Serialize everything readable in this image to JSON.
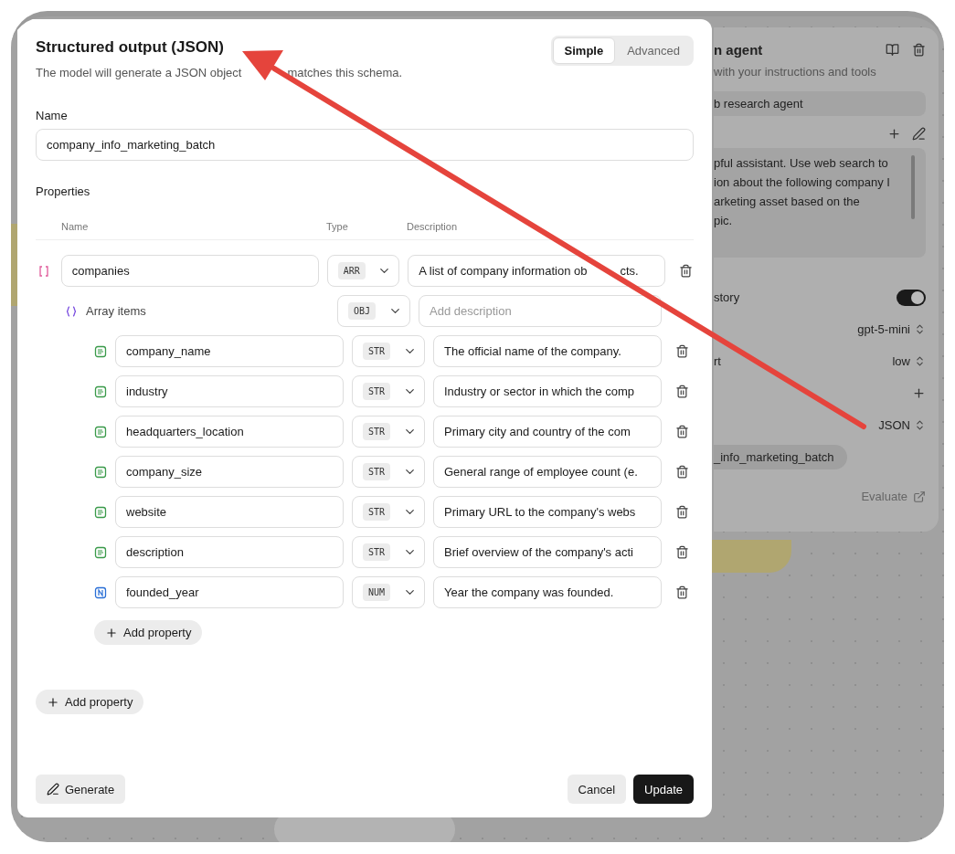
{
  "background_panel": {
    "title": "n agent",
    "subtitle": "with your instructions and tools",
    "name_value": "b research agent",
    "instructions": [
      "pful assistant. Use web search to",
      "ion about the following company I",
      "arketing asset based on the",
      "pic."
    ],
    "settings": [
      {
        "kind": "toggle",
        "label": "story",
        "on": true
      },
      {
        "kind": "select",
        "value": "gpt-5-mini"
      },
      {
        "kind": "select",
        "label": "rt",
        "value": "low"
      },
      {
        "kind": "add"
      },
      {
        "kind": "select",
        "value": "JSON"
      }
    ],
    "schema_chip": "_info_marketing_batch",
    "evaluate": "Evaluate"
  },
  "dialog": {
    "title": "Structured output (JSON)",
    "subtitle": [
      "The model will generate a JSON object",
      "matches this schema."
    ],
    "tabs": [
      {
        "label": "Simple",
        "selected": true
      },
      {
        "label": "Advanced",
        "selected": false
      }
    ],
    "name_label": "Name",
    "name_value": "company_info_marketing_batch",
    "properties_label": "Properties",
    "columns": [
      "Name",
      "Type",
      "Description"
    ],
    "properties": [
      {
        "kind": "array",
        "name": "companies",
        "type": "ARR",
        "description": [
          "A list of company information ob",
          "cts."
        ],
        "items": {
          "kind": "object",
          "label": "Array items",
          "type": "OBJ",
          "placeholder": "Add description",
          "properties": [
            {
              "kind": "string",
              "name": "company_name",
              "type": "STR",
              "description": "The official name of the company."
            },
            {
              "kind": "string",
              "name": "industry",
              "type": "STR",
              "description": "Industry or sector in which the comp"
            },
            {
              "kind": "string",
              "name": "headquarters_location",
              "type": "STR",
              "description": "Primary city and country of the com"
            },
            {
              "kind": "string",
              "name": "company_size",
              "type": "STR",
              "description": "General range of employee count (e."
            },
            {
              "kind": "string",
              "name": "website",
              "type": "STR",
              "description": "Primary URL to the company's webs"
            },
            {
              "kind": "string",
              "name": "description",
              "type": "STR",
              "description": "Brief overview of the company's acti"
            },
            {
              "kind": "number",
              "name": "founded_year",
              "type": "NUM",
              "description": "Year the company was founded."
            }
          ],
          "add_button": "Add property"
        }
      }
    ],
    "add_button": "Add property",
    "generate_button": "Generate",
    "cancel_button": "Cancel",
    "update_button": "Update"
  }
}
